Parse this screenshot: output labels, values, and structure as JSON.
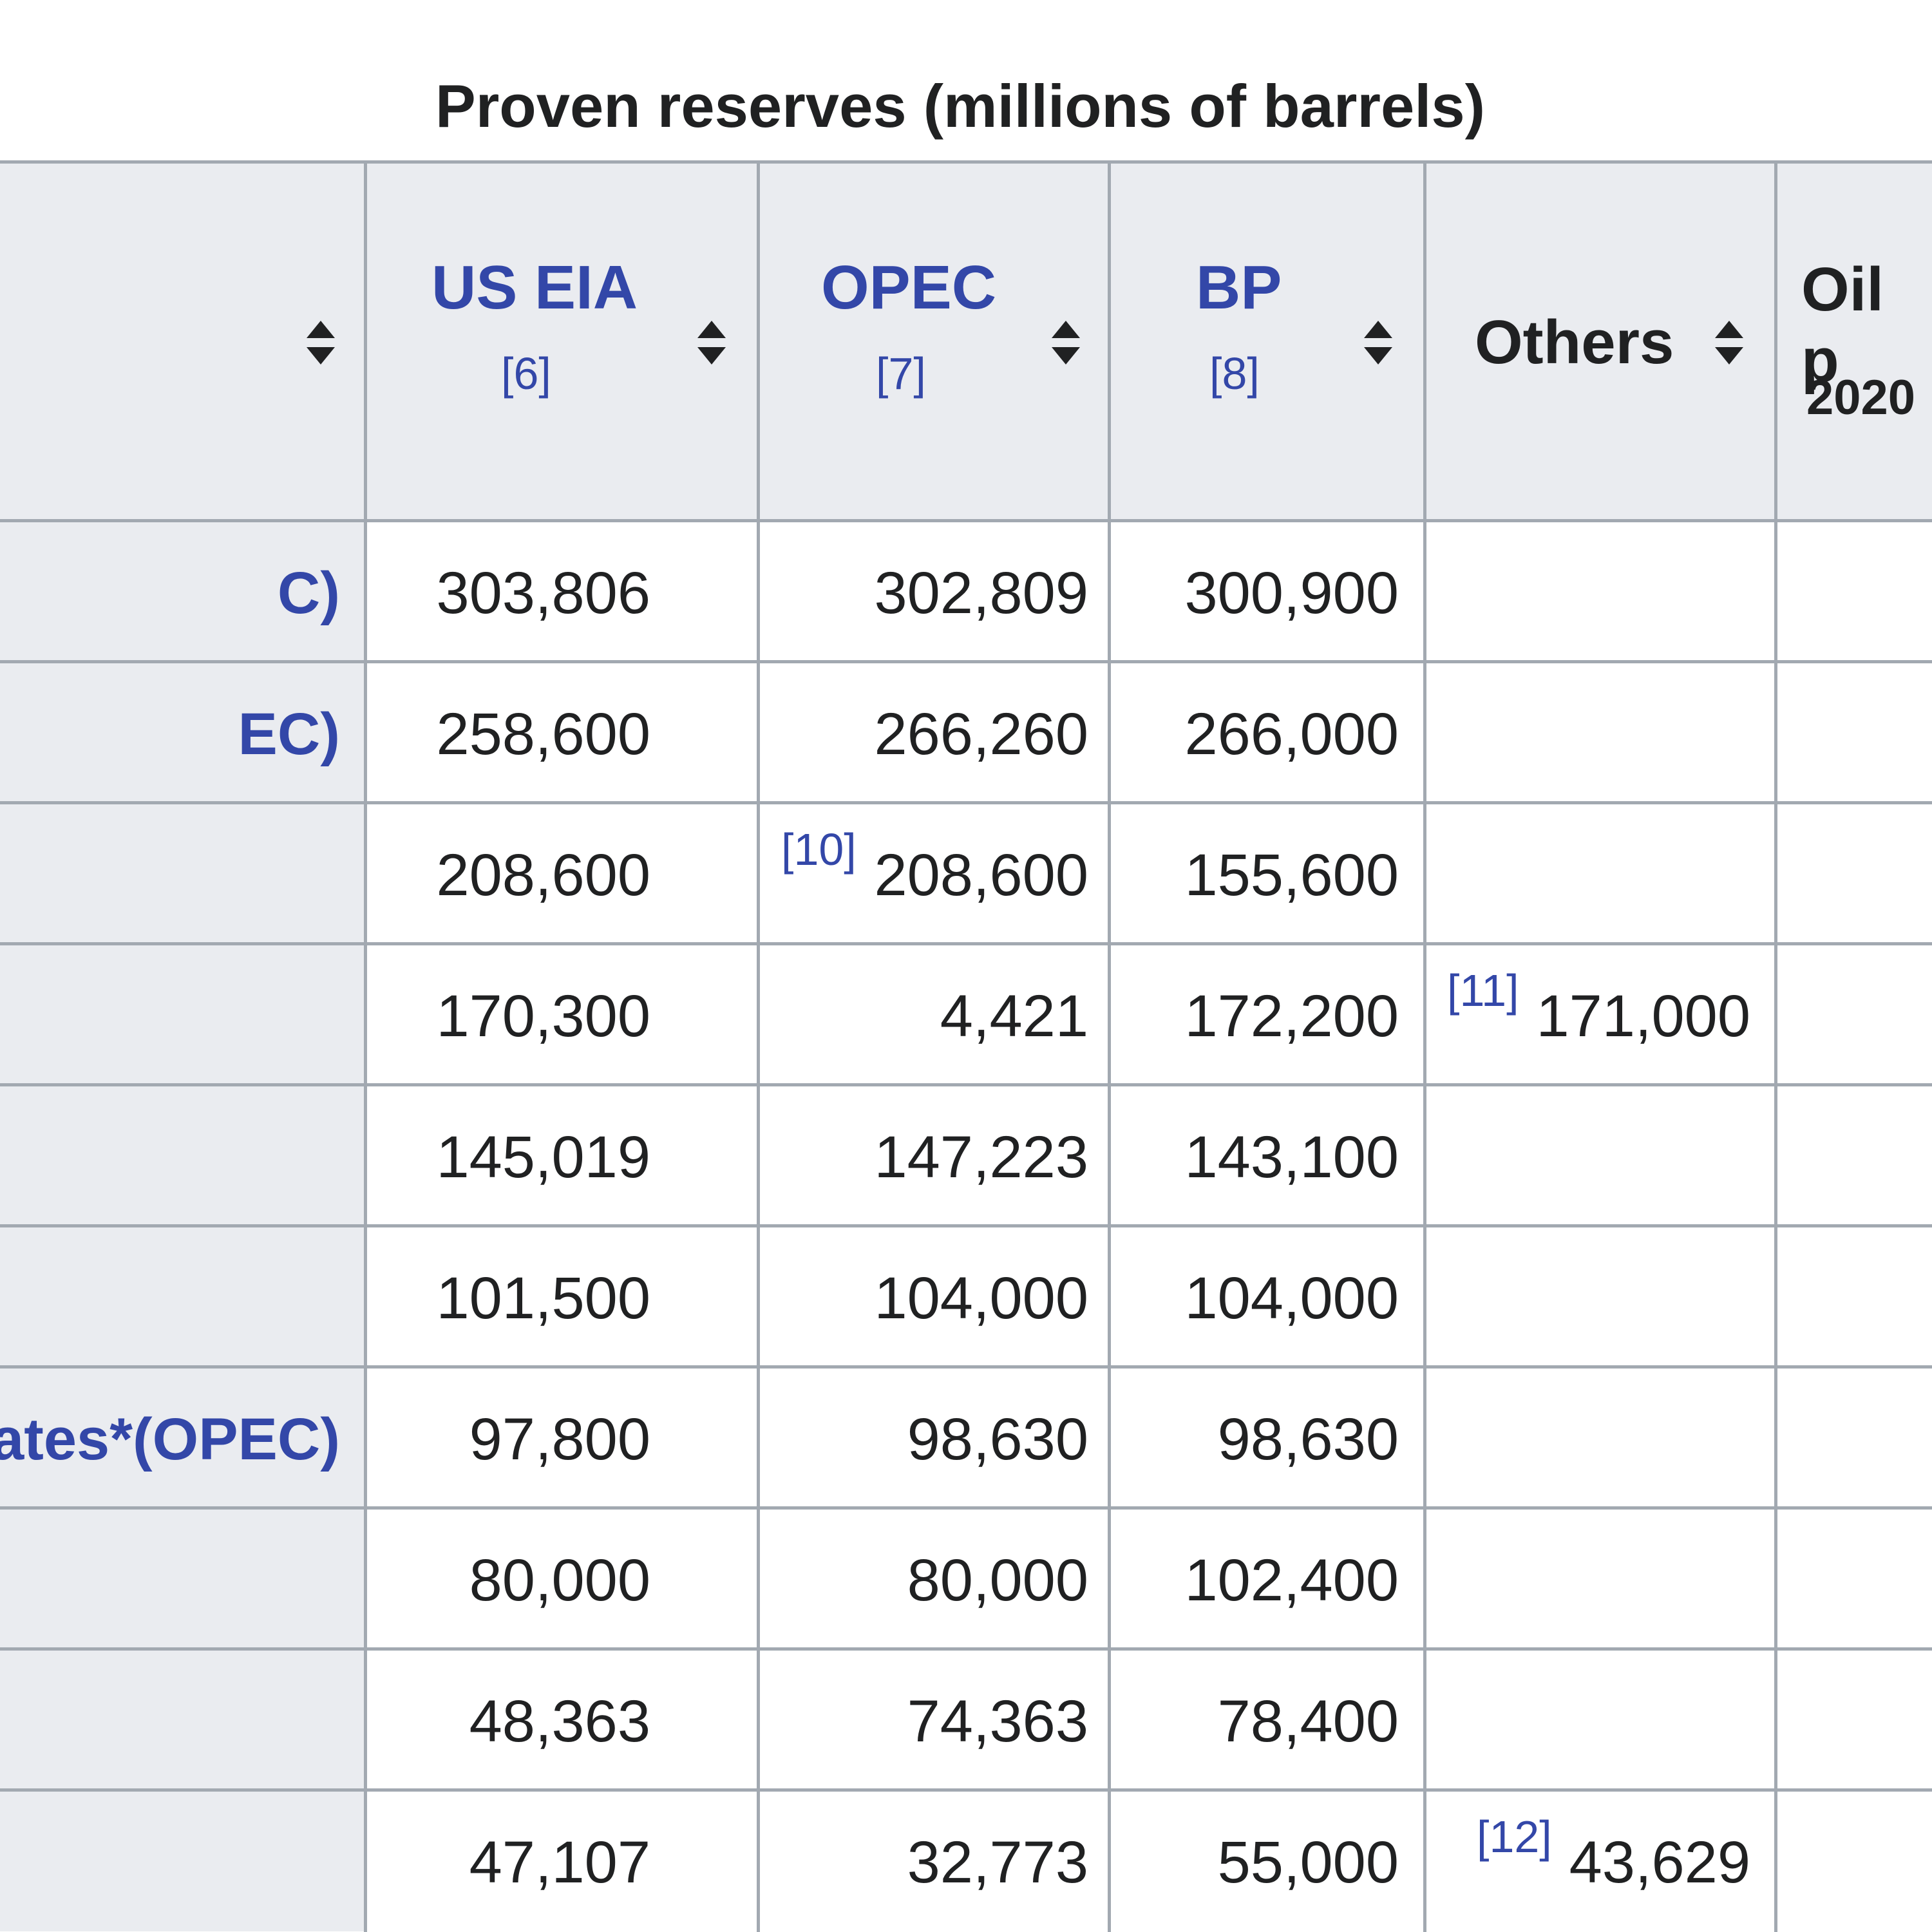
{
  "table": {
    "caption": "Proven reserves (millions of barrels)",
    "columns": [
      {
        "label": "",
        "ref": "",
        "sub": ""
      },
      {
        "label": "US EIA",
        "ref": "[6]",
        "sub": ""
      },
      {
        "label": "OPEC",
        "ref": "[7]",
        "sub": ""
      },
      {
        "label": "BP",
        "ref": "[8]",
        "sub": ""
      },
      {
        "label": "Others",
        "ref": "",
        "sub": ""
      },
      {
        "label": "Oil p",
        "ref": "",
        "sub": "2020"
      }
    ],
    "rows": [
      {
        "country": "C)",
        "us_eia": "303,806",
        "opec": "302,809",
        "opec_ref": "",
        "bp": "300,900",
        "others": "",
        "others_ref": ""
      },
      {
        "country": "EC)",
        "us_eia": "258,600",
        "opec": "266,260",
        "opec_ref": "",
        "bp": "266,000",
        "others": "",
        "others_ref": ""
      },
      {
        "country": "",
        "us_eia": "208,600",
        "opec": "208,600",
        "opec_ref": "[10]",
        "bp": "155,600",
        "others": "",
        "others_ref": ""
      },
      {
        "country": "",
        "us_eia": "170,300",
        "opec": "4,421",
        "opec_ref": "",
        "bp": "172,200",
        "others": "171,000",
        "others_ref": "[11]"
      },
      {
        "country": "",
        "us_eia": "145,019",
        "opec": "147,223",
        "opec_ref": "",
        "bp": "143,100",
        "others": "",
        "others_ref": ""
      },
      {
        "country": "",
        "us_eia": "101,500",
        "opec": "104,000",
        "opec_ref": "",
        "bp": "104,000",
        "others": "",
        "others_ref": ""
      },
      {
        "country": "ates*(OPEC)",
        "us_eia": "97,800",
        "opec": "98,630",
        "opec_ref": "",
        "bp": "98,630",
        "others": "",
        "others_ref": ""
      },
      {
        "country": "",
        "us_eia": "80,000",
        "opec": "80,000",
        "opec_ref": "",
        "bp": "102,400",
        "others": "",
        "others_ref": ""
      },
      {
        "country": "",
        "us_eia": "48,363",
        "opec": "74,363",
        "opec_ref": "",
        "bp": "78,400",
        "others": "",
        "others_ref": ""
      },
      {
        "country": "",
        "us_eia": "47,107",
        "opec": "32,773",
        "opec_ref": "",
        "bp": "55,000",
        "others": "43,629",
        "others_ref": "[12]"
      }
    ]
  },
  "colors": {
    "header_bg": "#eaecf0",
    "border": "#a2a9b1",
    "link": "#3347a8",
    "text": "#202122"
  },
  "icons": {
    "sort": "sort-arrows-icon"
  }
}
